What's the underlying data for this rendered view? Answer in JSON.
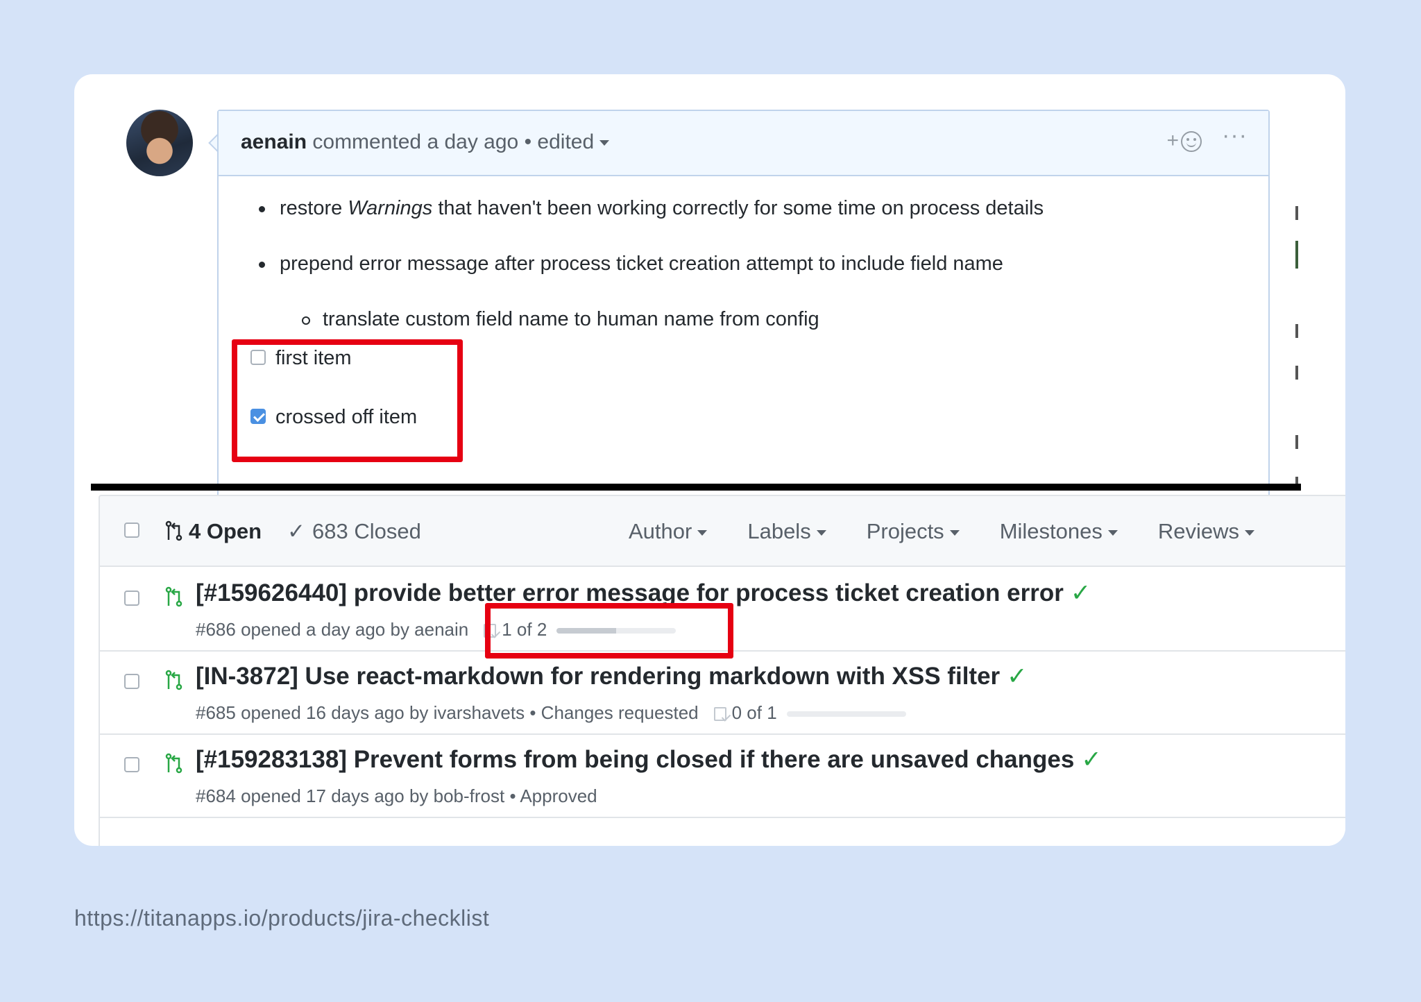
{
  "comment": {
    "author": "aenain",
    "action": " commented a day ago • edited",
    "reaction_label": "+",
    "more_label": "···",
    "bullets": [
      {
        "prefix": "restore ",
        "em": "Warnings",
        "suffix": " that haven't been working correctly for some time on process details"
      },
      {
        "text": "prepend error message after process ticket creation attempt to include field name"
      }
    ],
    "subbullet": "translate custom field name to human name from config",
    "tasks": [
      {
        "label": "first item",
        "checked": false
      },
      {
        "label": "crossed off item",
        "checked": true
      }
    ]
  },
  "pr_list": {
    "open_label": "4 Open",
    "closed_label": "683 Closed",
    "filters": [
      "Author",
      "Labels",
      "Projects",
      "Milestones",
      "Reviews"
    ],
    "rows": [
      {
        "title": "[#159626440] provide better error message for process ticket creation error",
        "status_icon": "check-icon",
        "meta": "#686 opened a day ago by aenain",
        "tasks_label": "1 of 2",
        "tasks_progress": 0.5
      },
      {
        "title": "[IN-3872] Use react-markdown for rendering markdown with XSS filter",
        "status_icon": "check-icon",
        "meta": "#685 opened 16 days ago by ivarshavets • Changes requested",
        "tasks_label": "0 of 1",
        "tasks_progress": 0
      },
      {
        "title": "[#159283138] Prevent forms from being closed if there are unsaved changes",
        "status_icon": "check-icon",
        "meta": "#684 opened 17 days ago by bob-frost • Approved"
      }
    ]
  },
  "highlight_color": "#e60012",
  "footer_url": "https://titanapps.io/products/jira-checklist"
}
